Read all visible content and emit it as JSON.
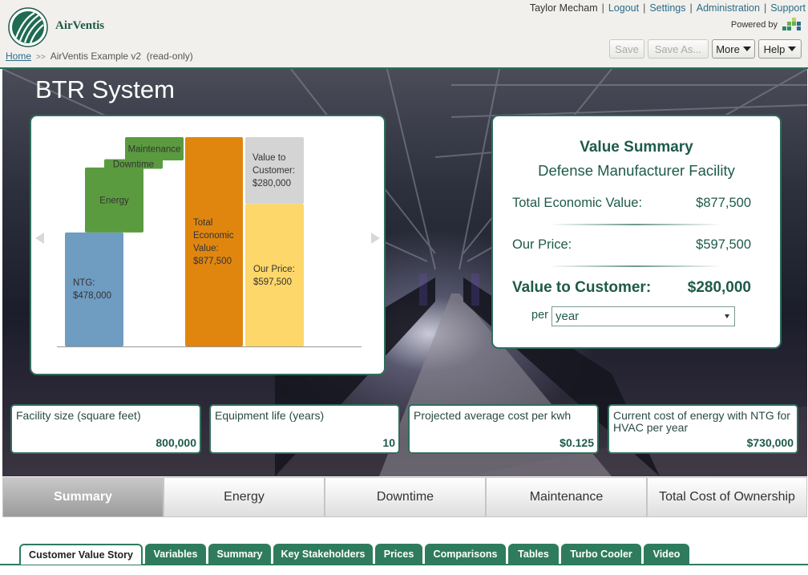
{
  "app": {
    "brand": "AirVentis"
  },
  "breadcrumb": {
    "home": "Home",
    "current": "AirVentis Example v2  (read-only)"
  },
  "toplinks": {
    "user": "Taylor Mecham",
    "logout": "Logout",
    "settings": "Settings",
    "administration": "Administration",
    "support": "Support"
  },
  "powered_by": "Powered by",
  "toolbar": {
    "save": "Save",
    "save_as": "Save As...",
    "more": "More",
    "help": "Help"
  },
  "hero": {
    "title": "BTR System"
  },
  "chart_data": {
    "type": "bar",
    "title": "",
    "bars": [
      {
        "label": "NTG:",
        "value_label": "$478,000",
        "start": 0,
        "end": 478000,
        "color": "#6f9cc1"
      },
      {
        "label": "Energy",
        "start": 478000,
        "end": 750000,
        "color": "#5b9b3f"
      },
      {
        "label": "Downtime",
        "start": 750000,
        "end": 780000,
        "color": "#5b9b3f"
      },
      {
        "label": "Maintenance",
        "start": 780000,
        "end": 877500,
        "color": "#5b9b3f"
      },
      {
        "label": "Total Economic Value:",
        "value_label": "$877,500",
        "start": 0,
        "end": 877500,
        "color": "#e0860f"
      },
      {
        "label": "Our Price:",
        "value_label": "$597,500",
        "start": 0,
        "end": 597500,
        "color": "#fdd769"
      },
      {
        "label": "Value to Customer:",
        "value_label": "$280,000",
        "start": 597500,
        "end": 877500,
        "color": "#d4d4d4"
      }
    ]
  },
  "value_summary": {
    "title": "Value Summary",
    "subtitle": "Defense Manufacturer Facility",
    "rows": [
      {
        "label": "Total Economic Value:",
        "value": "$877,500"
      },
      {
        "label": "Our Price:",
        "value": "$597,500"
      },
      {
        "label": "Value to Customer:",
        "value": "$280,000"
      }
    ],
    "per_label": "per",
    "period": "year"
  },
  "variables": [
    {
      "label": "Facility size (square feet)",
      "value": "800,000"
    },
    {
      "label": "Equipment life (years)",
      "value": "10"
    },
    {
      "label": "Projected average cost per kwh",
      "value": "$0.125"
    },
    {
      "label": "Current cost of energy with NTG for HVAC per year",
      "value": "$730,000"
    }
  ],
  "main_tabs": [
    "Summary",
    "Energy",
    "Downtime",
    "Maintenance",
    "Total Cost of Ownership"
  ],
  "bottom_tabs": [
    "Customer Value Story",
    "Variables",
    "Summary",
    "Key Stakeholders",
    "Prices",
    "Comparisons",
    "Tables",
    "Turbo Cooler",
    "Video"
  ],
  "colors": {
    "accent": "#2e7c5d",
    "brand_text": "#1e5a4a"
  }
}
